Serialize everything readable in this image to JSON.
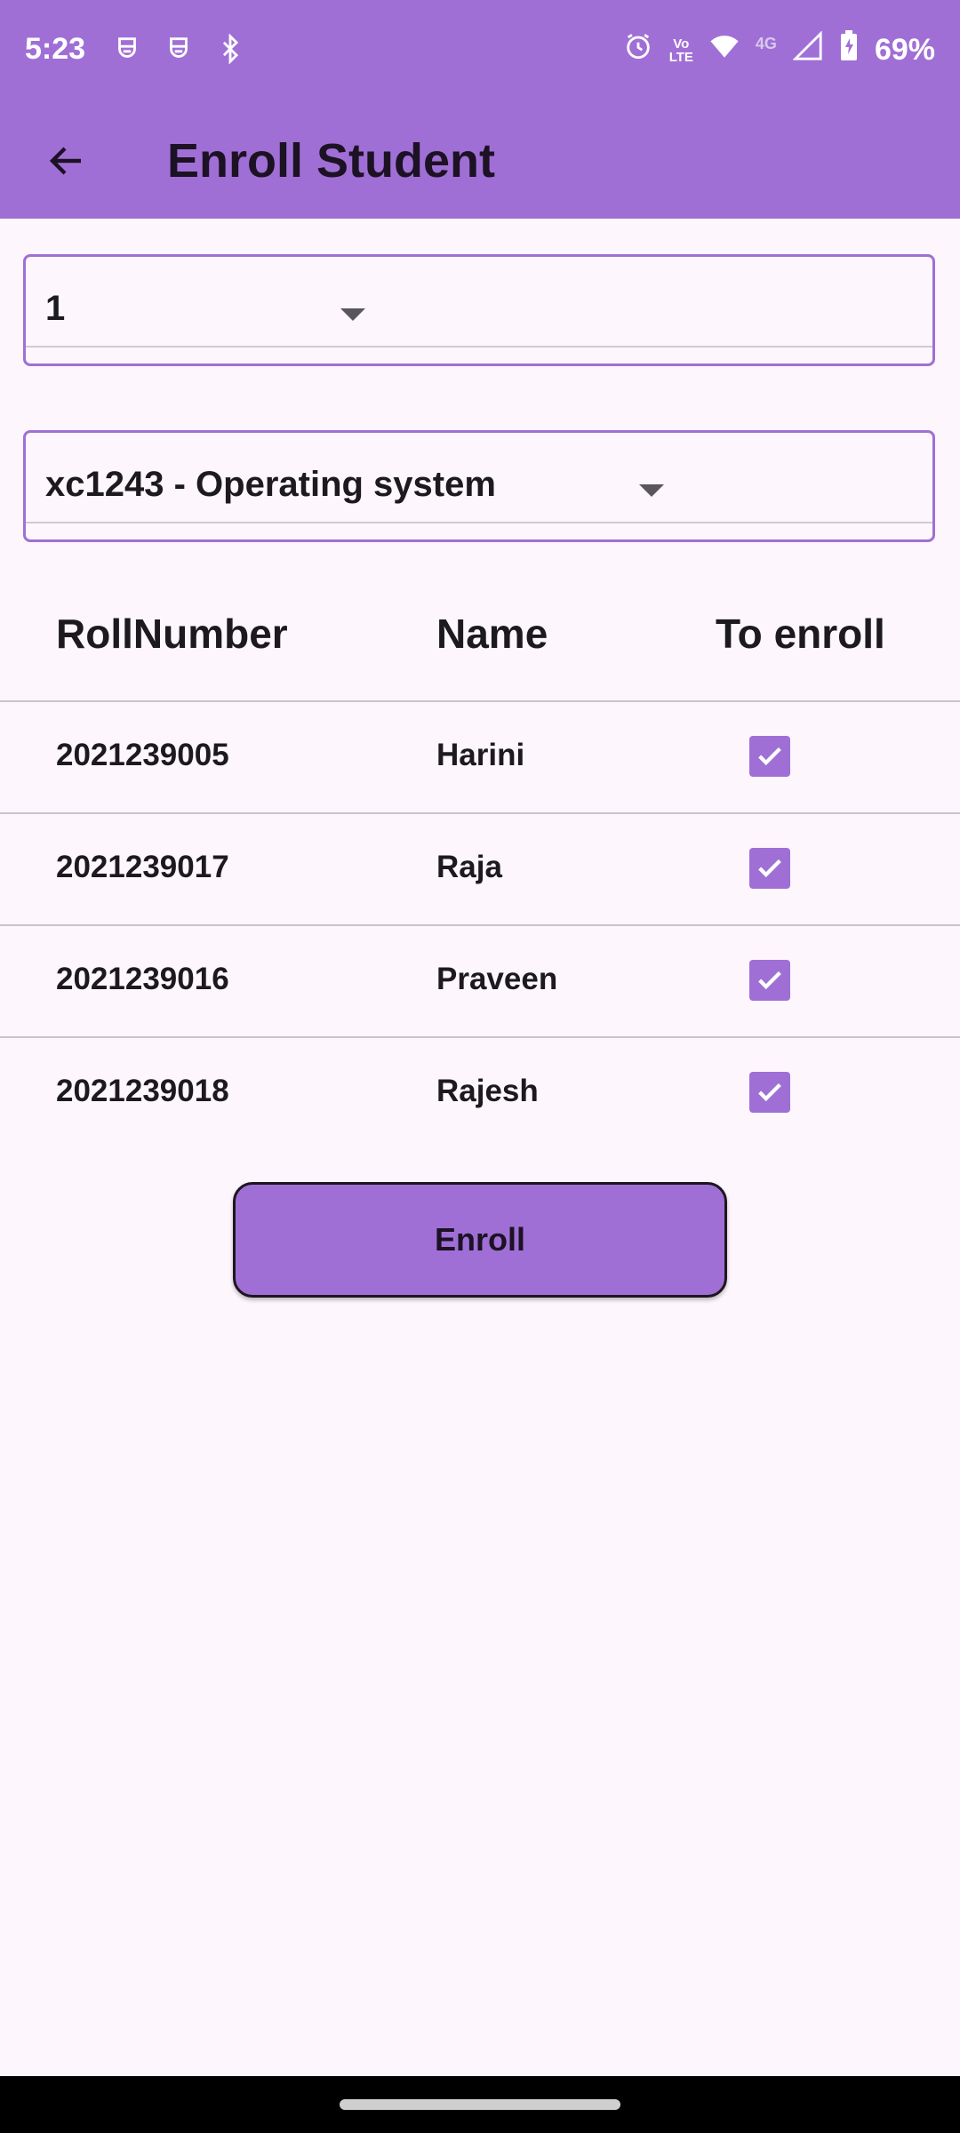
{
  "status_bar": {
    "time": "5:23",
    "left_icons": [
      "notification-app-icon",
      "notification-app-icon",
      "bluetooth-icon"
    ],
    "right_icons": [
      "alarm-icon",
      "volte-icon",
      "wifi-icon",
      "4g-icon",
      "signal-icon",
      "battery-charging-icon"
    ],
    "volte_label_top": "Vo",
    "volte_label_bottom": "LTE",
    "network_label": "4G",
    "battery": "69%"
  },
  "app_bar": {
    "title": "Enroll Student",
    "background": "#A06FD6"
  },
  "semester_dropdown": {
    "selected": "1"
  },
  "course_dropdown": {
    "selected": "xc1243 - Operating system"
  },
  "table": {
    "headers": [
      "RollNumber",
      "Name",
      "To enroll"
    ],
    "rows": [
      {
        "roll": "2021239005",
        "name": "Harini",
        "checked": true
      },
      {
        "roll": "2021239017",
        "name": "Raja",
        "checked": true
      },
      {
        "roll": "2021239016",
        "name": "Praveen",
        "checked": true
      },
      {
        "roll": "2021239018",
        "name": "Rajesh",
        "checked": true
      }
    ]
  },
  "enroll_button": {
    "label": "Enroll"
  },
  "colors": {
    "accent": "#A06FD6",
    "background": "#FDF6FC"
  }
}
